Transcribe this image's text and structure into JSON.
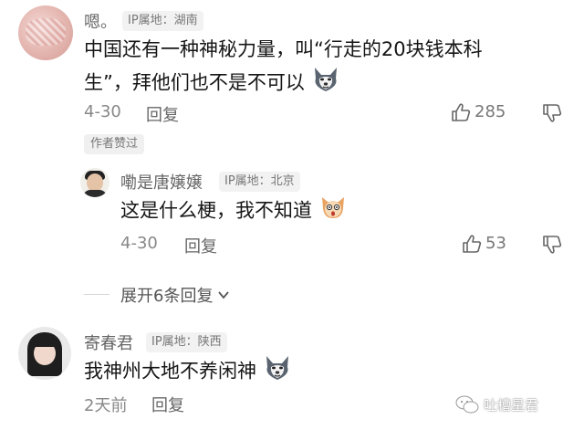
{
  "comments": [
    {
      "username": "嗯。",
      "ip": "IP属地：湖南",
      "text_line1": "中国还有一种神秘力量，叫“行走的20块钱本科",
      "text_line2": "生”，拜他们也不是不可以",
      "date": "4-30",
      "reply_label": "回复",
      "likes": "285",
      "author_badge": "作者赞过"
    },
    {
      "username": "嘞是唐嬢嬢",
      "ip": "IP属地：北京",
      "text": "这是什么梗，我不知道",
      "date": "4-30",
      "reply_label": "回复",
      "likes": "53"
    },
    {
      "username": "寄春君",
      "ip": "IP属地：陕西",
      "text": "我神州大地不养闲神",
      "date": "2天前",
      "reply_label": "回复"
    }
  ],
  "expand_replies": "展开6条回复",
  "watermark": "吐槽星君",
  "icons": {
    "like": "thumb-up-icon",
    "dislike": "thumb-down-icon",
    "dog_emoji": "husky-emoji-icon",
    "shock_emoji": "shocked-face-emoji-icon",
    "expand": "chevron-down-icon",
    "watermark": "wechat-icon"
  }
}
